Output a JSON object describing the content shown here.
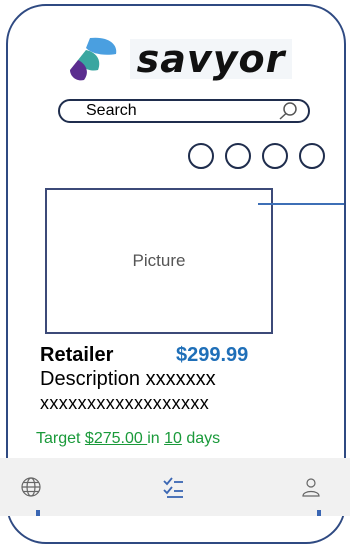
{
  "brand": {
    "name": "savyor",
    "colors": {
      "leaf_top": "#4a9fe0",
      "leaf_bottom": "#5b2d8f"
    }
  },
  "search": {
    "label": "Search",
    "icon": "search-icon"
  },
  "carousel": {
    "dots": 4
  },
  "product": {
    "picture_label": "Picture",
    "retailer": "Retailer",
    "price": "$299.99",
    "description_line1": "Description xxxxxxx",
    "description_line2": "xxxxxxxxxxxxxxxxxx",
    "target": {
      "prefix": "Target ",
      "price": "$275.00 ",
      "middle": "in ",
      "days": "10",
      "suffix": " days"
    }
  },
  "nav": {
    "tabs": [
      {
        "icon": "globe-icon",
        "active": false
      },
      {
        "icon": "checklist-icon",
        "active": true
      },
      {
        "icon": "user-icon",
        "active": false
      }
    ]
  }
}
